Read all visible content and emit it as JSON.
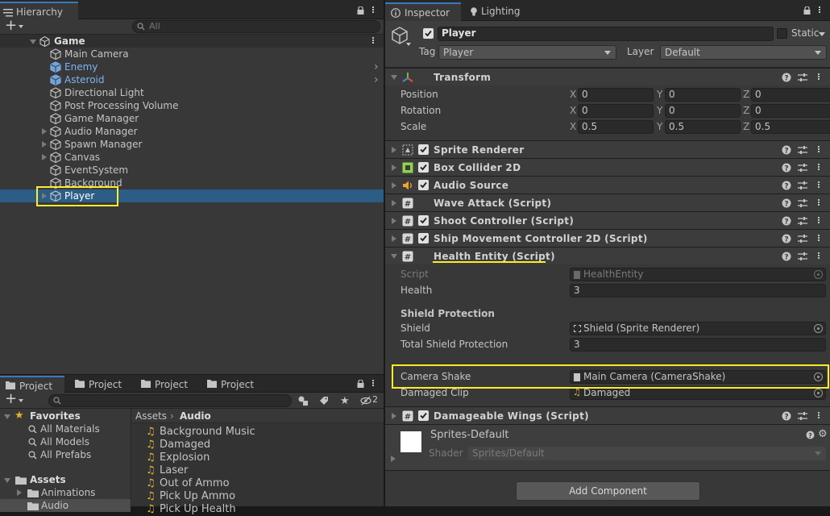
{
  "hierarchy": {
    "tab_label": "Hierarchy",
    "add_label": "+",
    "search_placeholder": "All",
    "scene_name": "Game",
    "items": [
      {
        "label": "Main Camera",
        "style": "normal"
      },
      {
        "label": "Enemy",
        "style": "prefab"
      },
      {
        "label": "Asteroid",
        "style": "prefab"
      },
      {
        "label": "Directional Light",
        "style": "normal"
      },
      {
        "label": "Post Processing Volume",
        "style": "normal"
      },
      {
        "label": "Game Manager",
        "style": "normal"
      },
      {
        "label": "Audio Manager",
        "style": "normal"
      },
      {
        "label": "Spawn Manager",
        "style": "normal"
      },
      {
        "label": "Canvas",
        "style": "normal"
      },
      {
        "label": "EventSystem",
        "style": "normal"
      },
      {
        "label": "Background",
        "style": "normal"
      },
      {
        "label": "Player",
        "style": "selected"
      }
    ]
  },
  "project": {
    "tabs": [
      "Project",
      "Project",
      "Project",
      "Project"
    ],
    "add_label": "+",
    "hidden_count": "2",
    "favorites_label": "Favorites",
    "favorites": [
      "All Materials",
      "All Models",
      "All Prefabs"
    ],
    "assets_label": "Assets",
    "asset_folders": [
      "Animations",
      "Audio"
    ],
    "breadcrumb_root": "Assets",
    "breadcrumb_current": "Audio",
    "files": [
      "Background Music",
      "Damaged",
      "Explosion",
      "Laser",
      "Out of Ammo",
      "Pick Up Ammo",
      "Pick Up Health"
    ]
  },
  "inspector": {
    "tab_label": "Inspector",
    "lighting_tab_label": "Lighting",
    "object_name": "Player",
    "static_label": "Static",
    "tag_label": "Tag",
    "tag_value": "Player",
    "layer_label": "Layer",
    "layer_value": "Default",
    "transform": {
      "title": "Transform",
      "position_label": "Position",
      "rotation_label": "Rotation",
      "scale_label": "Scale",
      "axis_x": "X",
      "axis_y": "Y",
      "axis_z": "Z",
      "position": [
        "0",
        "0",
        "0"
      ],
      "rotation": [
        "0",
        "0",
        "0"
      ],
      "scale": [
        "0.5",
        "0.5",
        "0.5"
      ]
    },
    "components": [
      "Sprite Renderer",
      "Box Collider 2D",
      "Audio Source",
      "Wave Attack (Script)",
      "Shoot Controller (Script)",
      "Ship Movement Controller 2D (Script)"
    ],
    "health_entity": {
      "title": "Health Entity (Script)",
      "script_label": "Script",
      "script_value": "HealthEntity",
      "health_label": "Health",
      "health_value": "3",
      "shield_section": "Shield Protection",
      "shield_label": "Shield",
      "shield_value": "Shield (Sprite Renderer)",
      "total_label": "Total Shield Protection",
      "total_value": "3",
      "camera_shake_label": "Camera Shake",
      "camera_shake_value": "Main Camera (CameraShake)",
      "damaged_clip_label": "Damaged Clip",
      "damaged_clip_value": "Damaged"
    },
    "damageable_wings": "Damageable Wings (Script)",
    "material_name": "Sprites-Default",
    "shader_label": "Shader",
    "shader_value": "Sprites/Default",
    "add_component_label": "Add Component"
  },
  "colors": {
    "highlight": "#ffeb26",
    "selection": "#2c5d87",
    "prefab_text": "#7cb4f0",
    "panel_bg": "#383838"
  }
}
